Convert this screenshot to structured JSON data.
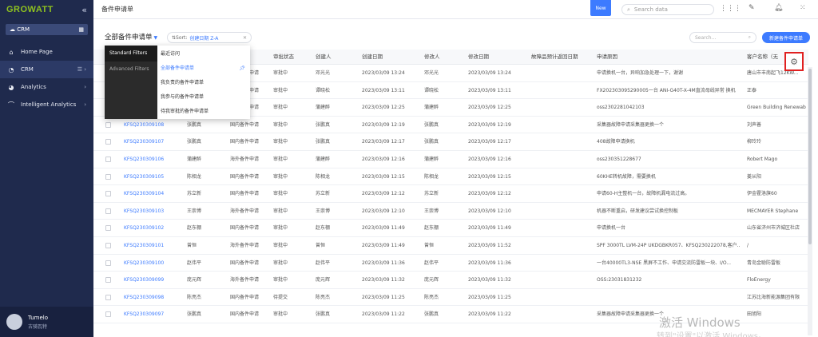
{
  "sidebar": {
    "logo": "GROWATT",
    "collapse": "«",
    "module": "CRM",
    "items": [
      {
        "label": "Home Page",
        "icon": "⌂"
      },
      {
        "label": "CRM",
        "icon": "◔"
      },
      {
        "label": "Analytics",
        "icon": "◕"
      },
      {
        "label": "Intelligent Analytics",
        "icon": "⌒"
      }
    ],
    "user": {
      "name": "Tumelo",
      "sub": "古骑瓦特"
    }
  },
  "topbar": {
    "title": "备件申请单",
    "new_badge": "New",
    "search_placeholder": "Search data"
  },
  "toolbar": {
    "list_title": "全部备件申请单",
    "sort_label": "Sort:",
    "sort_value": "创建日期 Z-A",
    "search_placeholder": "Search...",
    "new_button": "新建备件申请单"
  },
  "dropdown": {
    "left": [
      "Standard Filters",
      "Advanced Filters"
    ],
    "right": [
      "最近访问",
      "全部备件申请单",
      "我负责的备件申请单",
      "我参与的备件申请单",
      "待我审批的备件申请单"
    ]
  },
  "columns": [
    "",
    "",
    "审批状态",
    "创建人",
    "创建日期",
    "修改人",
    "修改日期",
    "故障品预计返回日期",
    "申请原因",
    "客户名称（无"
  ],
  "rows": [
    {
      "code": "",
      "owner": "",
      "type": "国内备件申请",
      "status": "审批中",
      "creator": "邓光光",
      "created": "2023/03/09 13:24",
      "modifier": "邓光光",
      "modified": "2023/03/09 13:24",
      "reason": "申请换机一台，异响加急处理一下，谢谢",
      "customer": "唐山市丰南起飞12KW..."
    },
    {
      "code": "",
      "owner": "",
      "type": "国内备件申请",
      "status": "审批中",
      "creator": "谭晓松",
      "created": "2023/03/09 13:11",
      "modifier": "谭晓松",
      "modified": "2023/03/09 13:11",
      "reason": "FX202303095290005一台 ANI-G40T-X-4M直流母线异常 换机",
      "customer": "正泰"
    },
    {
      "code": "",
      "owner": "",
      "type": "海外备件申请",
      "status": "审批中",
      "creator": "蒲建醉",
      "created": "2023/03/09 12:25",
      "modifier": "蒲建醉",
      "modified": "2023/03/09 12:25",
      "reason": "oss2302281042103",
      "customer": "Green Building Renewab"
    },
    {
      "code": "KFSQ230309108",
      "owner": "张鹏真",
      "type": "国内备件申请",
      "status": "审批中",
      "creator": "张鹏真",
      "created": "2023/03/09 12:19",
      "modifier": "张鹏真",
      "modified": "2023/03/09 12:19",
      "reason": "采集器故障申请采集器更换一个",
      "customer": "刘声善"
    },
    {
      "code": "KFSQ230309107",
      "owner": "张鹏真",
      "type": "国内备件申请",
      "status": "审批中",
      "creator": "张鹏真",
      "created": "2023/03/09 12:17",
      "modifier": "张鹏真",
      "modified": "2023/03/09 12:17",
      "reason": "408故障申请换机",
      "customer": "柳玲玲"
    },
    {
      "code": "KFSQ230309106",
      "owner": "蒲建醉",
      "type": "海外备件申请",
      "status": "审批中",
      "creator": "蒲建醉",
      "created": "2023/03/09 12:16",
      "modifier": "蒲建醉",
      "modified": "2023/03/09 12:16",
      "reason": "oss230351228677",
      "customer": "Robert Mago"
    },
    {
      "code": "KFSQ230309105",
      "owner": "陈相龙",
      "type": "国内备件申请",
      "status": "审批中",
      "creator": "陈相龙",
      "created": "2023/03/09 12:15",
      "modifier": "陈相龙",
      "modified": "2023/03/09 12:15",
      "reason": "60KHE转机故障，需要换机",
      "customer": "姜从阳"
    },
    {
      "code": "KFSQ230309104",
      "owner": "苏立新",
      "type": "国内备件申请",
      "status": "审批中",
      "creator": "苏立新",
      "created": "2023/03/09 12:12",
      "modifier": "苏立新",
      "modified": "2023/03/09 12:12",
      "reason": "申请60-H主整机一台，故障机漏电流过高。",
      "customer": "伊金霍洛旗60"
    },
    {
      "code": "KFSQ230309103",
      "owner": "王崇博",
      "type": "海外备件申请",
      "status": "审批中",
      "creator": "王崇博",
      "created": "2023/03/09 12:10",
      "modifier": "王崇博",
      "modified": "2023/03/09 12:10",
      "reason": "机器不断重启，研发建议尝试换控制板",
      "customer": "MECMAYER Stephane"
    },
    {
      "code": "KFSQ230309102",
      "owner": "赵东棚",
      "type": "国内备件申请",
      "status": "审批中",
      "creator": "赵东棚",
      "created": "2023/03/09 11:49",
      "modifier": "赵东棚",
      "modified": "2023/03/09 11:49",
      "reason": "申请换机一台",
      "customer": "山东省济州市济城区杜店"
    },
    {
      "code": "KFSQ230309101",
      "owner": "曾恒",
      "type": "海外备件申请",
      "status": "审批中",
      "creator": "曾恒",
      "created": "2023/03/09 11:49",
      "modifier": "曾恒",
      "modified": "2023/03/09 11:52",
      "reason": "SPF 3000TL LVM-24P UKDGBKR057、KFSQ230222078,客户...",
      "customer": "/"
    },
    {
      "code": "KFSQ230309100",
      "owner": "赵伟平",
      "type": "国内备件申请",
      "status": "审批中",
      "creator": "赵伟平",
      "created": "2023/03/09 11:36",
      "modifier": "赵伟平",
      "modified": "2023/03/09 11:36",
      "reason": "一台40000TL3-NSE 黑屏不工作、申请交流防雷板一块、I/O...",
      "customer": "青岛金聪防雷板"
    },
    {
      "code": "KFSQ230309099",
      "owner": "庞元辉",
      "type": "海外备件申请",
      "status": "审批中",
      "creator": "庞元辉",
      "created": "2023/03/09 11:32",
      "modifier": "庞元辉",
      "modified": "2023/03/09 11:32",
      "reason": "OSS:23031831232",
      "customer": "FloEnergy"
    },
    {
      "code": "KFSQ230309098",
      "owner": "陈亮杰",
      "type": "国内备件申请",
      "status": "待提交",
      "creator": "陈亮杰",
      "created": "2023/03/09 11:25",
      "modifier": "陈亮杰",
      "modified": "2023/03/09 11:25",
      "reason": "",
      "customer": "江苏比海新能源集团有限"
    },
    {
      "code": "KFSQ230309097",
      "owner": "张鹏真",
      "type": "国内备件申请",
      "status": "审批中",
      "creator": "张鹏真",
      "created": "2023/03/09 11:22",
      "modifier": "张鹏真",
      "modified": "2023/03/09 11:22",
      "reason": "采集器故障申请采集器更换一个",
      "customer": "田旭阳"
    }
  ],
  "watermark": {
    "line1": "激活 Windows",
    "line2": "转到\"设置\"以激活 Windows。"
  }
}
